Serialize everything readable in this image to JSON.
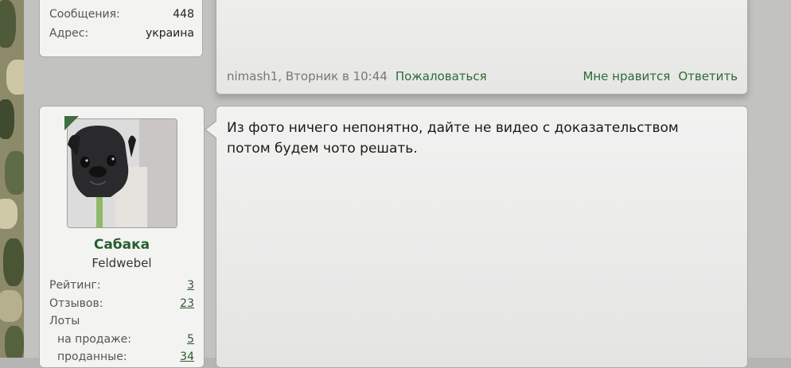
{
  "previous_post": {
    "stats": [
      {
        "label": "Сообщения:",
        "value": "448"
      },
      {
        "label": "Адрес:",
        "value": "украина"
      }
    ],
    "meta": "nimash1, Вторник в 10:44",
    "report_link": "Пожаловаться",
    "like_link": "Мне нравится",
    "reply_link": "Ответить"
  },
  "post": {
    "author": {
      "name": "Сабака",
      "title": "Feldwebel",
      "stats": [
        {
          "label": "Рейтинг:",
          "value": "3"
        },
        {
          "label": "Отзывов:",
          "value": "23"
        },
        {
          "label": "Лоты",
          "value": ""
        },
        {
          "label": "на продаже:",
          "value": "5"
        },
        {
          "label": "проданные:",
          "value": "34"
        }
      ]
    },
    "text": "Из фото ничего непонятно, дайте не видео с доказательством потом будем чото решать."
  },
  "colors": {
    "link_green": "#2d6b3a",
    "username_green": "#255e2d",
    "panel_bg": "#f3f3f2",
    "page_bg": "#c2c2c0"
  }
}
